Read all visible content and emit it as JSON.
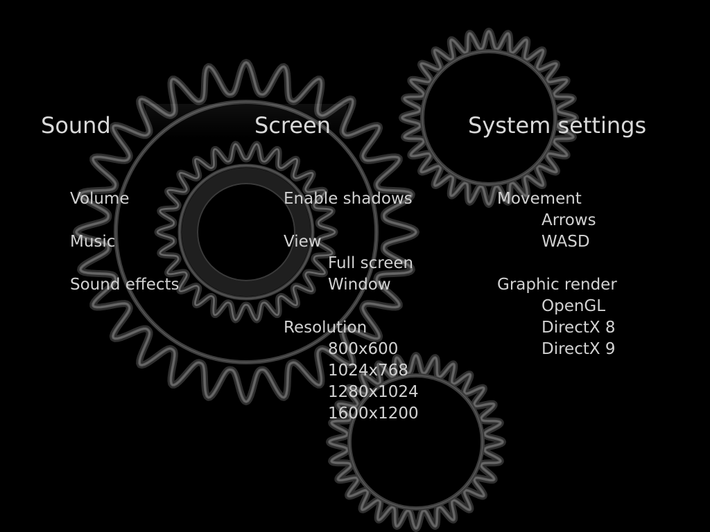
{
  "sections": {
    "sound": {
      "title": "Sound",
      "items": [
        "Volume",
        "Music",
        "Sound effects"
      ]
    },
    "screen": {
      "title": "Screen",
      "enable_shadows": "Enable shadows",
      "view": {
        "label": "View",
        "options": [
          "Full screen",
          "Window"
        ]
      },
      "resolution": {
        "label": "Resolution",
        "options": [
          "800x600",
          "1024x768",
          "1280x1024",
          "1600x1200"
        ]
      }
    },
    "system": {
      "title": "System settings",
      "movement": {
        "label": "Movement",
        "options": [
          "Arrows",
          "WASD"
        ]
      },
      "graphic_render": {
        "label": "Graphic render",
        "options": [
          "OpenGL",
          "DirectX 8",
          "DirectX 9"
        ]
      }
    }
  },
  "decor": {
    "icons": [
      "large-gear-icon",
      "inner-gear-icon",
      "top-right-gear-icon",
      "bottom-gear-icon"
    ],
    "colors": {
      "background": "#000000",
      "text": "#d6d6d6",
      "gear": "#5a5a5a"
    }
  }
}
